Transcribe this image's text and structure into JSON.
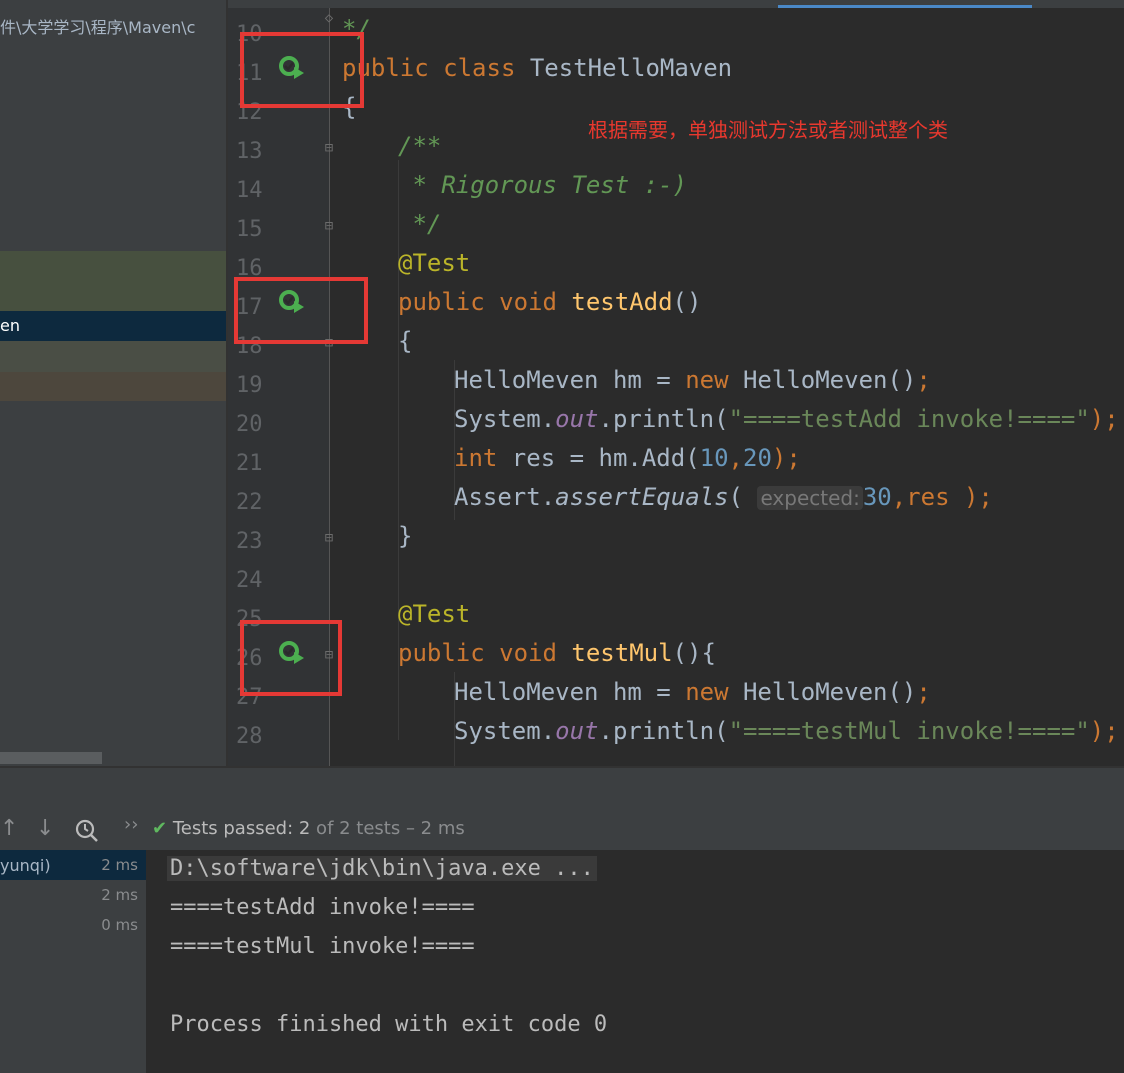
{
  "project_panel": {
    "path": "件\\大学学习\\程序\\Maven\\c",
    "selected_item": "en"
  },
  "editor": {
    "annotation_note": "根据需要，单独测试方法或者测试整个类",
    "lines": [
      {
        "n": "10"
      },
      {
        "n": "11"
      },
      {
        "n": "12"
      },
      {
        "n": "13"
      },
      {
        "n": "14"
      },
      {
        "n": "15"
      },
      {
        "n": "16"
      },
      {
        "n": "17"
      },
      {
        "n": "18"
      },
      {
        "n": "19"
      },
      {
        "n": "20"
      },
      {
        "n": "21"
      },
      {
        "n": "22"
      },
      {
        "n": "23"
      },
      {
        "n": "24"
      },
      {
        "n": "25"
      },
      {
        "n": "26"
      },
      {
        "n": "27"
      },
      {
        "n": "28"
      }
    ],
    "code": {
      "l10": "*/",
      "l11_kw": "public class ",
      "l11_name": "TestHelloMaven",
      "l12": "{",
      "l13": "/**",
      "l14": " * Rigorous Test :-)",
      "l15": " */",
      "l16": "@Test",
      "l17_kw": "public void ",
      "l17_fn": "testAdd",
      "l17_rest": "()",
      "l18": "{",
      "l19_a": "HelloMeven hm = ",
      "l19_kw": "new ",
      "l19_b": "HelloMeven()",
      "l19_c": ";",
      "l20_a": "System.",
      "l20_fld": "out",
      "l20_b": ".println(",
      "l20_str": "\"====testAdd invoke!====\"",
      "l20_c": ");",
      "l21_kw": "int ",
      "l21_a": "res = hm.Add(",
      "l21_n1": "10",
      "l21_comma": ",",
      "l21_n2": "20",
      "l21_b": ");",
      "l22_a": "Assert.",
      "l22_fn": "assertEquals",
      "l22_b": "( ",
      "l22_hint": "expected:",
      "l22_num": "30",
      "l22_c": ",res );",
      "l23": "}",
      "l25": "@Test",
      "l26_kw": "public void ",
      "l26_fn": "testMul",
      "l26_rest": "(){",
      "l27_a": "HelloMeven hm = ",
      "l27_kw": "new ",
      "l27_b": "HelloMeven()",
      "l27_c": ";",
      "l28_a": "System.",
      "l28_fld": "out",
      "l28_b": ".println(",
      "l28_str": "\"====testMul invoke!====\"",
      "l28_c": ");"
    }
  },
  "run_window": {
    "status_prefix": "Tests passed: ",
    "passed": "2",
    "status_suffix": " of 2 tests – 2 ms",
    "tests": [
      {
        "name": "yunqi)",
        "time": "2 ms"
      },
      {
        "name": "",
        "time": "2 ms"
      },
      {
        "name": "",
        "time": "0 ms"
      }
    ],
    "console": [
      "D:\\software\\jdk\\bin\\java.exe ...",
      "====testAdd invoke!====",
      "====testMul invoke!====",
      "",
      "Process finished with exit code 0"
    ]
  },
  "colors": {
    "accent": "#4a88c7",
    "highlight": "#e53935",
    "pass": "#5fb85f"
  }
}
